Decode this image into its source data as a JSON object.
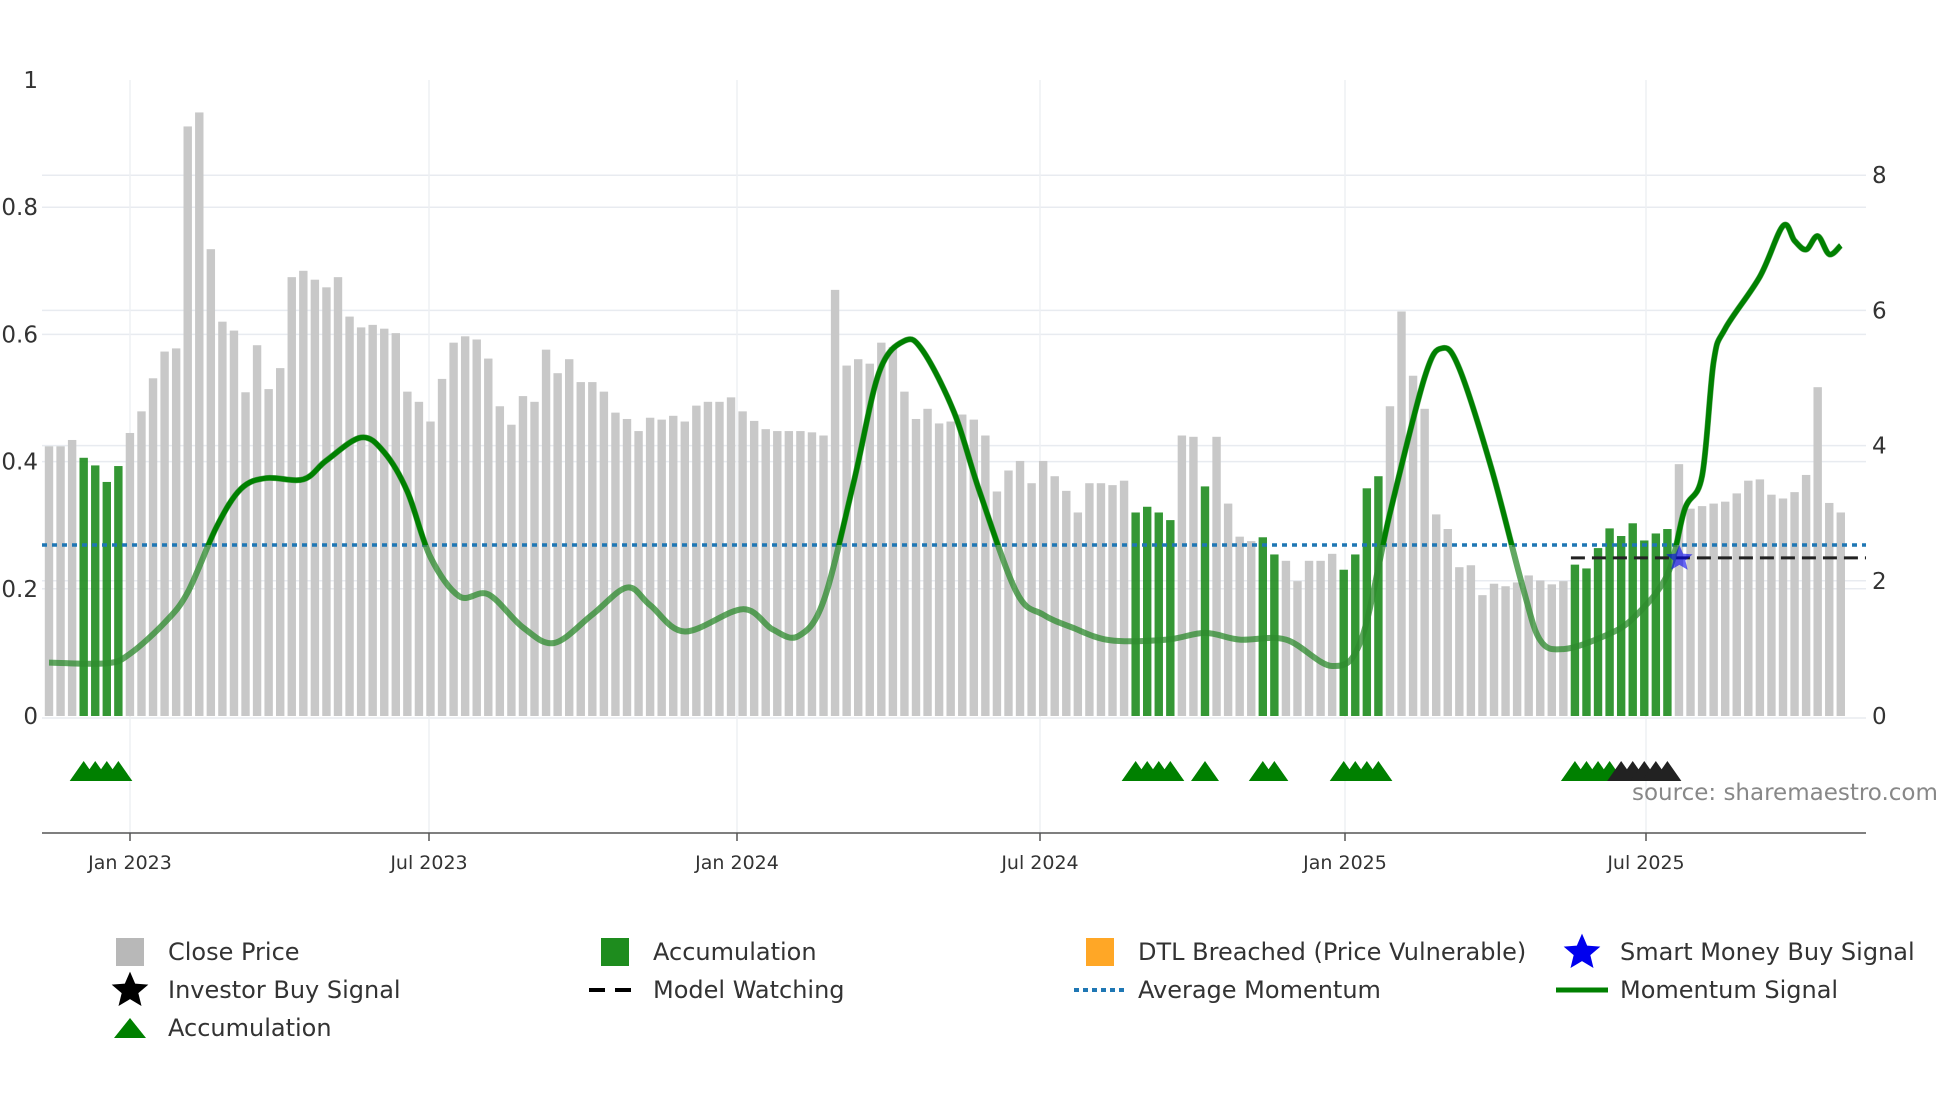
{
  "chart_data": {
    "type": "bar",
    "title": "",
    "left_axis": {
      "ticks": [
        "0",
        "0.2",
        "0.4",
        "0.6",
        "0.8",
        "1"
      ],
      "range": [
        0,
        1
      ]
    },
    "right_axis": {
      "ticks": [
        "0",
        "2",
        "4",
        "6",
        "8"
      ],
      "range": [
        0,
        9.4
      ]
    },
    "x_ticks": [
      "Jan 2023",
      "Jul 2023",
      "Jan 2024",
      "Jul 2024",
      "Jan 2025",
      "Jul 2025"
    ],
    "close_price": [
      0.424,
      0.424,
      0.434,
      0.406,
      0.394,
      0.368,
      0.393,
      0.445,
      0.479,
      0.531,
      0.573,
      0.578,
      0.927,
      0.949,
      0.734,
      0.62,
      0.606,
      0.509,
      0.583,
      0.514,
      0.547,
      0.69,
      0.7,
      0.686,
      0.674,
      0.69,
      0.628,
      0.611,
      0.615,
      0.609,
      0.602,
      0.51,
      0.494,
      0.463,
      0.53,
      0.587,
      0.597,
      0.592,
      0.562,
      0.487,
      0.458,
      0.503,
      0.494,
      0.576,
      0.539,
      0.561,
      0.525,
      0.525,
      0.51,
      0.477,
      0.467,
      0.448,
      0.469,
      0.466,
      0.472,
      0.463,
      0.488,
      0.494,
      0.494,
      0.501,
      0.479,
      0.464,
      0.451,
      0.448,
      0.448,
      0.448,
      0.446,
      0.441,
      0.67,
      0.551,
      0.561,
      0.554,
      0.587,
      0.58,
      0.51,
      0.467,
      0.483,
      0.46,
      0.463,
      0.474,
      0.466,
      0.441,
      0.353,
      0.386,
      0.401,
      0.366,
      0.401,
      0.377,
      0.354,
      0.32,
      0.366,
      0.366,
      0.363,
      0.37,
      0.32,
      0.329,
      0.32,
      0.308,
      0.441,
      0.439,
      0.361,
      0.439,
      0.334,
      0.282,
      0.275,
      0.281,
      0.254,
      0.244,
      0.212,
      0.244,
      0.244,
      0.255,
      0.23,
      0.254,
      0.358,
      0.377,
      0.487,
      0.636,
      0.535,
      0.483,
      0.317,
      0.294,
      0.234,
      0.237,
      0.19,
      0.208,
      0.204,
      0.21,
      0.221,
      0.213,
      0.207,
      0.212,
      0.238,
      0.232,
      0.264,
      0.295,
      0.283,
      0.303,
      0.276,
      0.287,
      0.294,
      0.396,
      0.326,
      0.33,
      0.334,
      0.337,
      0.35,
      0.37,
      0.372,
      0.348,
      0.342,
      0.352,
      0.379,
      0.517,
      0.335,
      0.32
    ],
    "accumulation_bars": [
      3,
      4,
      5,
      6,
      94,
      95,
      96,
      97,
      100,
      105,
      106,
      112,
      113,
      114,
      115,
      132,
      133,
      134,
      135,
      136,
      137,
      138,
      139,
      140
    ],
    "momentum_signal": [
      [
        0,
        0.79
      ],
      [
        5,
        0.78
      ],
      [
        7,
        0.92
      ],
      [
        10,
        1.38
      ],
      [
        12,
        1.83
      ],
      [
        14.5,
        2.8
      ],
      [
        16.6,
        3.36
      ],
      [
        18.8,
        3.52
      ],
      [
        22,
        3.5
      ],
      [
        24,
        3.78
      ],
      [
        27,
        4.12
      ],
      [
        29,
        3.9
      ],
      [
        31,
        3.32
      ],
      [
        33,
        2.35
      ],
      [
        35.5,
        1.77
      ],
      [
        38,
        1.8
      ],
      [
        41,
        1.31
      ],
      [
        43.7,
        1.08
      ],
      [
        47,
        1.5
      ],
      [
        50,
        1.9
      ],
      [
        52,
        1.64
      ],
      [
        55,
        1.25
      ],
      [
        60,
        1.58
      ],
      [
        62.6,
        1.28
      ],
      [
        64.8,
        1.18
      ],
      [
        67,
        1.7
      ],
      [
        69.6,
        3.45
      ],
      [
        71.8,
        5.08
      ],
      [
        74,
        5.55
      ],
      [
        75.6,
        5.4
      ],
      [
        78.3,
        4.49
      ],
      [
        80.5,
        3.32
      ],
      [
        83.7,
        1.83
      ],
      [
        86,
        1.5
      ],
      [
        88.5,
        1.31
      ],
      [
        91.8,
        1.12
      ],
      [
        96.7,
        1.13
      ],
      [
        100,
        1.23
      ],
      [
        103,
        1.13
      ],
      [
        107,
        1.13
      ],
      [
        111,
        0.74
      ],
      [
        113.5,
        1.12
      ],
      [
        116,
        3.0
      ],
      [
        119,
        5.01
      ],
      [
        120.5,
        5.44
      ],
      [
        122,
        5.14
      ],
      [
        124.8,
        3.65
      ],
      [
        127.5,
        1.9
      ],
      [
        129,
        1.12
      ],
      [
        131,
        0.99
      ],
      [
        134.5,
        1.18
      ],
      [
        137,
        1.44
      ],
      [
        140,
        2.09
      ],
      [
        141.5,
        3.06
      ],
      [
        143,
        3.55
      ],
      [
        144,
        5.24
      ],
      [
        145,
        5.73
      ],
      [
        148,
        6.5
      ],
      [
        150,
        7.25
      ],
      [
        151,
        7.03
      ],
      [
        152,
        6.9
      ],
      [
        153,
        7.1
      ],
      [
        154,
        6.83
      ],
      [
        155,
        6.96
      ]
    ],
    "average_momentum": 2.53,
    "model_watching": {
      "level": 2.34,
      "from_bar": 132
    },
    "smart_money_buy_signal_bar": 141,
    "investor_buy_signal_bars": [
      136,
      137,
      138,
      139,
      140
    ],
    "accumulation_markers": [
      3,
      4,
      5,
      6,
      94,
      95,
      96,
      97,
      100,
      105,
      106,
      112,
      113,
      114,
      115,
      132,
      133,
      134,
      135
    ],
    "legend": [
      "Close Price",
      "Accumulation",
      "DTL Breached (Price Vulnerable)",
      "Smart Money Buy Signal",
      "Investor Buy Signal",
      "Model Watching",
      "Average Momentum",
      "Momentum Signal",
      "Accumulation"
    ],
    "colors": {
      "close": "#c8c8c8",
      "accum": "#1e8c1e",
      "dtl": "#ffa726",
      "smart": "#0000ee",
      "investor": "#000000",
      "watch": "#000000",
      "avg": "#1f77b4",
      "momentum": "#008000",
      "triangle": "#008000"
    }
  },
  "source": "source: sharemaestro.com"
}
